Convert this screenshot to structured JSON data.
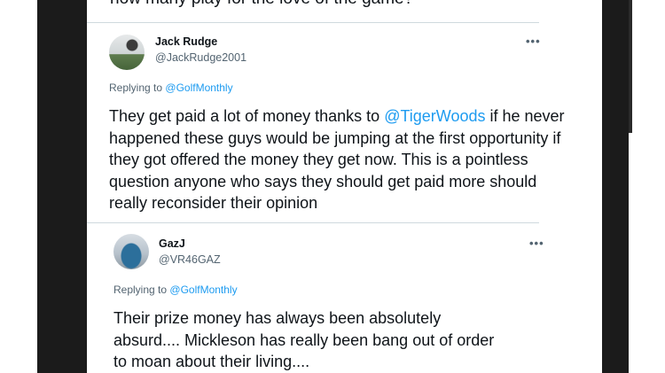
{
  "top_partial_text": "how many play for the love of the game?",
  "tweets": [
    {
      "name": "Jack Rudge",
      "handle": "@JackRudge2001",
      "more": "•••",
      "replying_prefix": "Replying to",
      "replying_to": "@GolfMonthly",
      "text_before": "They get paid a lot of money thanks to ",
      "text_mention": "@TigerWoods",
      "text_after": " if he never happened these guys would be jumping at the first opportunity if they got offered the money they get now. This is a pointless question anyone who says they should get paid more should really reconsider their opinion"
    },
    {
      "name": "GazJ",
      "handle": "@VR46GAZ",
      "more": "•••",
      "replying_prefix": "Replying to",
      "replying_to": "@GolfMonthly",
      "text": "Their prize money has always been absolutely absurd.... Mickleson has really been bang out of order to moan about their living...."
    }
  ]
}
